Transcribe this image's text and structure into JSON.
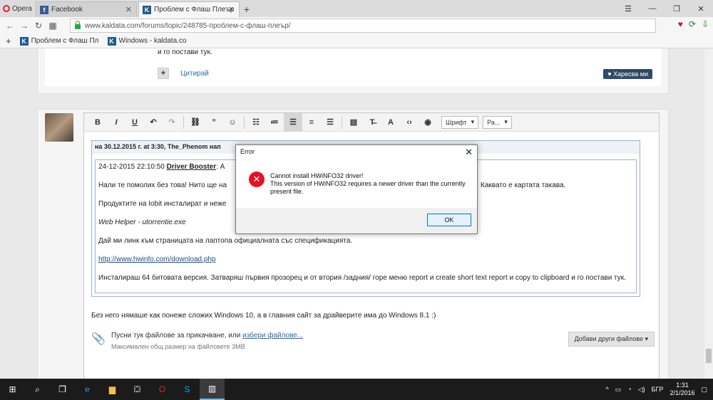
{
  "browser": {
    "menu_label": "Opera",
    "tabs": [
      {
        "title": "Facebook",
        "icon": "facebook-icon"
      },
      {
        "title": "Проблем с Флаш Плеър",
        "icon": "kaldata-icon"
      }
    ],
    "url": "www.kaldata.com/forums/topic/248785-проблем-с-флаш-плеър/",
    "bookmarks": [
      {
        "label": "Проблем с Флаш Пл"
      },
      {
        "label": "Windows - kaldata.co"
      }
    ]
  },
  "previous_post": {
    "trailing_text": "и го постави тук.",
    "quote_label": "Цитирай",
    "like_label": "Харесва ми"
  },
  "editor": {
    "font_select": "Шрифт",
    "size_select": "Ра...",
    "quote_header": "на 30.12.2015 г. at 3:30, The_Phenom нап",
    "quote": {
      "line1_time": "24-12-2015 22:10:50 ",
      "line1_link": "Driver Booster",
      "line1_rest": ": А",
      "p2": "Нали те помолих без това! Нито ще на",
      "p2_end": "Каквато е картата такава.",
      "p3": "Продуктите на Iobit инсталират и неже",
      "p4": "Web Helper - utorrentie.exe",
      "p5": "Дай ми линк към страницата на лаптопа официалната със спецификацията.",
      "p6": "http://www.hwinfo.com/download.php",
      "p7": "Инсталираш 64 битовата версия. Затваряш първия прозорец и от втория /задния/ горе меню report и create short text report и copy to clipboard и го постави тук."
    },
    "reply_text": "Без него нямаше как понеже сложих Windows 10, а в главния сайт за драйверите има до Windows 8.1 :)"
  },
  "attachments": {
    "text": "Пусни тук файлове за прикачване, или ",
    "link": "избери файлове...",
    "max_size": "Максимален общ размер на файловете 3MB",
    "add_button": "Добави други файлове ▾"
  },
  "dialog": {
    "title": "Error",
    "line1": "Cannot install HWiNFO32 driver!",
    "line2": "This version of HWiNFO32 requires a newer driver than the currently present file.",
    "ok_label": "OK"
  },
  "taskbar": {
    "language": "БГР",
    "time": "1:31",
    "date": "2/1/2016"
  }
}
